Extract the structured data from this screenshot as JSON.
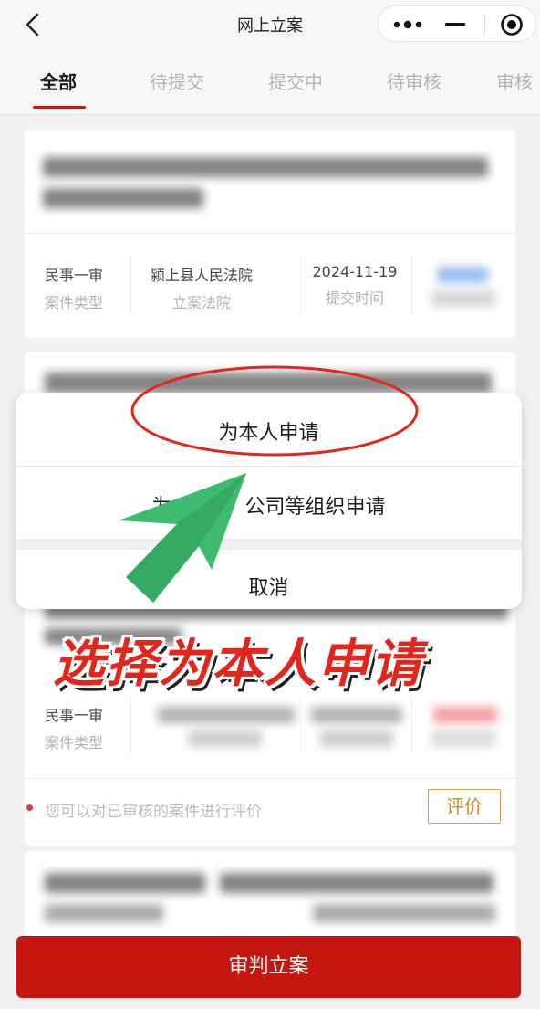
{
  "header": {
    "title": "网上立案",
    "icons": [
      "back-arrow-icon",
      "more-dots-icon",
      "minimize-icon",
      "close-circle-icon"
    ]
  },
  "tabs": [
    {
      "label": "全部",
      "active": true
    },
    {
      "label": "待提交",
      "active": false
    },
    {
      "label": "提交中",
      "active": false
    },
    {
      "label": "待审核",
      "active": false
    },
    {
      "label": "审核",
      "active": false
    }
  ],
  "case_card_1": {
    "case_type_value": "民事一审",
    "case_type_label": "案件类型",
    "court_value": "颍上县人民法院",
    "court_label": "立案法院",
    "submit_time_value": "2024-11-19",
    "submit_time_label": "提交时间"
  },
  "case_card_3": {
    "case_type_value": "民事一审",
    "case_type_label": "案件类型",
    "hint": "您可以对已审核的案件进行评价",
    "evaluate_label": "评价"
  },
  "action_sheet": {
    "option_self": "为本人申请",
    "option_org": "为他人或公司等组织申请",
    "option_org_visible": "为",
    "option_org_visible_tail": "公司等组织申请",
    "cancel": "取消"
  },
  "annotation": {
    "caption": "选择为本人申请",
    "arrow_color": "#3dbb6e",
    "circle_color": "#e0281f"
  },
  "bottom": {
    "button_label": "审判立案"
  },
  "colors": {
    "primary_red": "#c5160f",
    "tab_underline": "#b81c1c",
    "evaluate_gold": "#c8901e"
  }
}
